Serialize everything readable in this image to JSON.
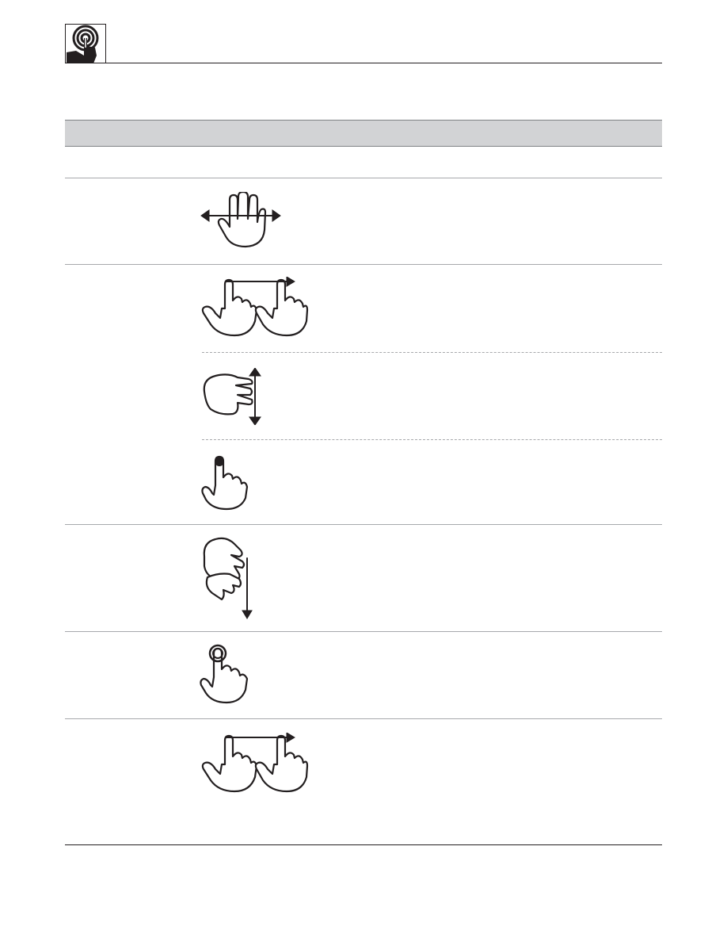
{
  "header": {
    "logo_icon": "touch-gesture-logo-icon"
  },
  "table": {
    "columns": [],
    "rows": [
      {
        "gestures": [
          "flat-hand-swipe-horizontal-icon"
        ]
      },
      {
        "gestures": [
          "two-hand-swipe-right-icon",
          "pinch-scroll-vertical-icon",
          "single-tap-icon"
        ]
      },
      {
        "gestures": [
          "palm-swipe-down-icon"
        ]
      },
      {
        "gestures": [
          "tap-hold-icon"
        ]
      },
      {
        "gestures": [
          "two-hand-swipe-right-icon"
        ]
      }
    ]
  }
}
